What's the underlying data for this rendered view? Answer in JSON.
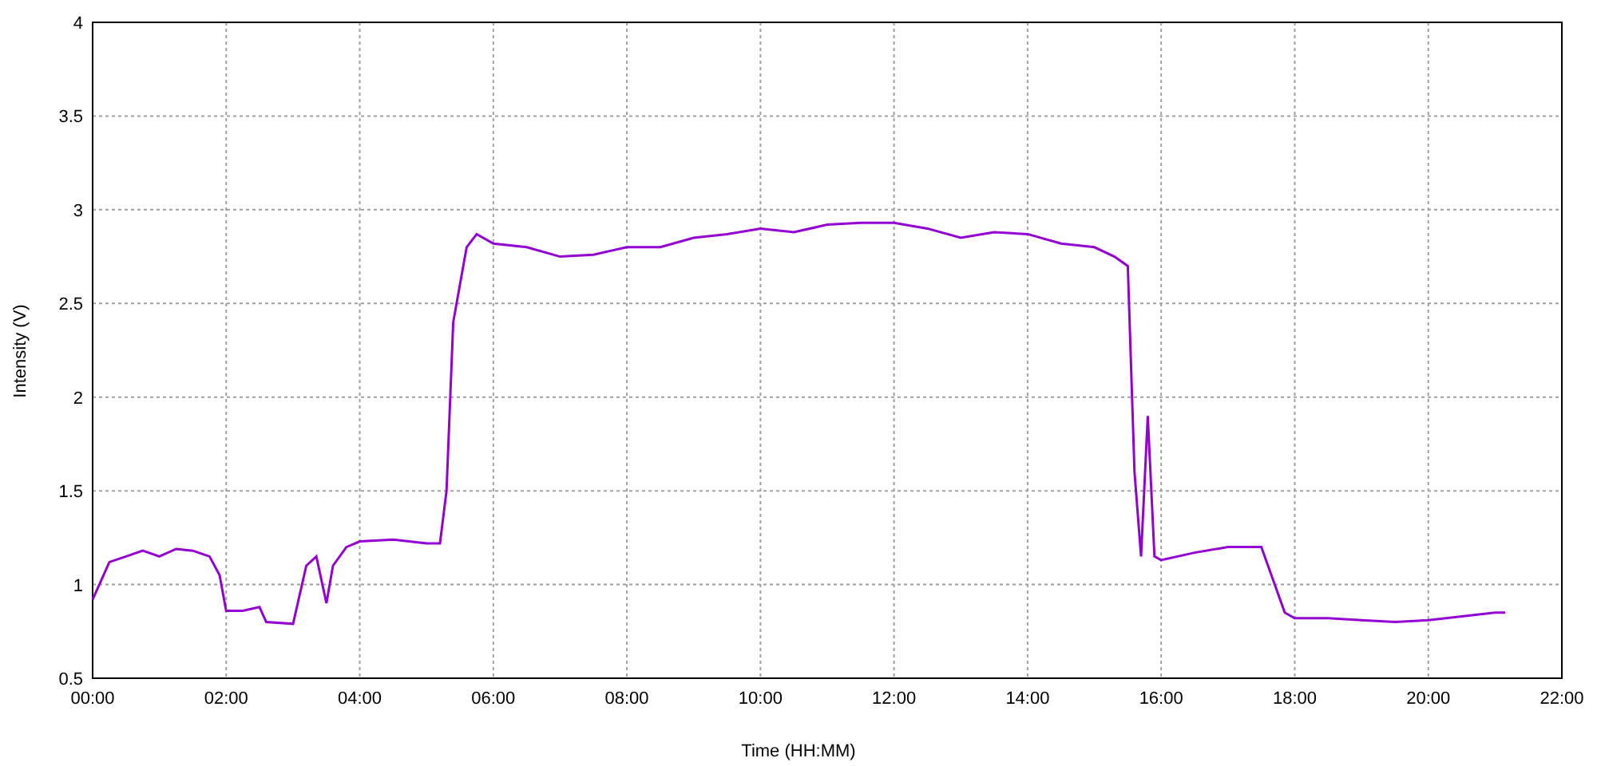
{
  "chart": {
    "chart_data": {
      "type": "line",
      "xlabel": "Time (HH:MM)",
      "ylabel": "Intensity (V)",
      "x": [
        0,
        0.25,
        0.5,
        0.75,
        1,
        1.25,
        1.5,
        1.75,
        1.9,
        2,
        2.25,
        2.5,
        2.6,
        3,
        3.2,
        3.35,
        3.5,
        3.6,
        3.8,
        4,
        4.5,
        5,
        5.2,
        5.3,
        5.4,
        5.5,
        5.6,
        5.75,
        6,
        6.5,
        7,
        7.5,
        8,
        8.5,
        9,
        9.5,
        10,
        10.5,
        11,
        11.5,
        12,
        12.5,
        13,
        13.5,
        14,
        14.5,
        15,
        15.3,
        15.5,
        15.6,
        15.7,
        15.8,
        15.9,
        16,
        16.5,
        17,
        17.5,
        17.7,
        17.85,
        18,
        18.5,
        19,
        19.5,
        20,
        20.5,
        21,
        21.15
      ],
      "grid": true,
      "series": [
        {
          "color": "#9400d3",
          "values": [
            0.92,
            1.12,
            1.15,
            1.18,
            1.15,
            1.19,
            1.18,
            1.15,
            1.05,
            0.86,
            0.86,
            0.88,
            0.8,
            0.79,
            1.1,
            1.15,
            0.9,
            1.1,
            1.2,
            1.23,
            1.24,
            1.22,
            1.22,
            1.5,
            2.4,
            2.6,
            2.8,
            2.87,
            2.82,
            2.8,
            2.75,
            2.76,
            2.8,
            2.8,
            2.85,
            2.87,
            2.9,
            2.88,
            2.92,
            2.93,
            2.93,
            2.9,
            2.85,
            2.88,
            2.87,
            2.82,
            2.8,
            2.75,
            2.7,
            1.6,
            1.15,
            1.9,
            1.15,
            1.13,
            1.17,
            1.2,
            1.2,
            1,
            0.85,
            0.82,
            0.82,
            0.81,
            0.8,
            0.81,
            0.83,
            0.85,
            0.85
          ]
        }
      ],
      "xlim": [
        0,
        22
      ],
      "ylim": [
        0.5,
        4
      ],
      "xticks": [
        {
          "value": 0,
          "label": "00:00"
        },
        {
          "value": 2,
          "label": "02:00"
        },
        {
          "value": 4,
          "label": "04:00"
        },
        {
          "value": 6,
          "label": "06:00"
        },
        {
          "value": 8,
          "label": "08:00"
        },
        {
          "value": 10,
          "label": "10:00"
        },
        {
          "value": 12,
          "label": "12:00"
        },
        {
          "value": 14,
          "label": "14:00"
        },
        {
          "value": 16,
          "label": "16:00"
        },
        {
          "value": 18,
          "label": "18:00"
        },
        {
          "value": 20,
          "label": "20:00"
        },
        {
          "value": 22,
          "label": "22:00"
        }
      ],
      "yticks": [
        {
          "value": 0.5,
          "label": "0.5"
        },
        {
          "value": 1,
          "label": "1"
        },
        {
          "value": 1.5,
          "label": "1.5"
        },
        {
          "value": 2,
          "label": "2"
        },
        {
          "value": 2.5,
          "label": "2.5"
        },
        {
          "value": 3,
          "label": "3"
        },
        {
          "value": 3.5,
          "label": "3.5"
        },
        {
          "value": 4,
          "label": "4"
        }
      ]
    }
  }
}
